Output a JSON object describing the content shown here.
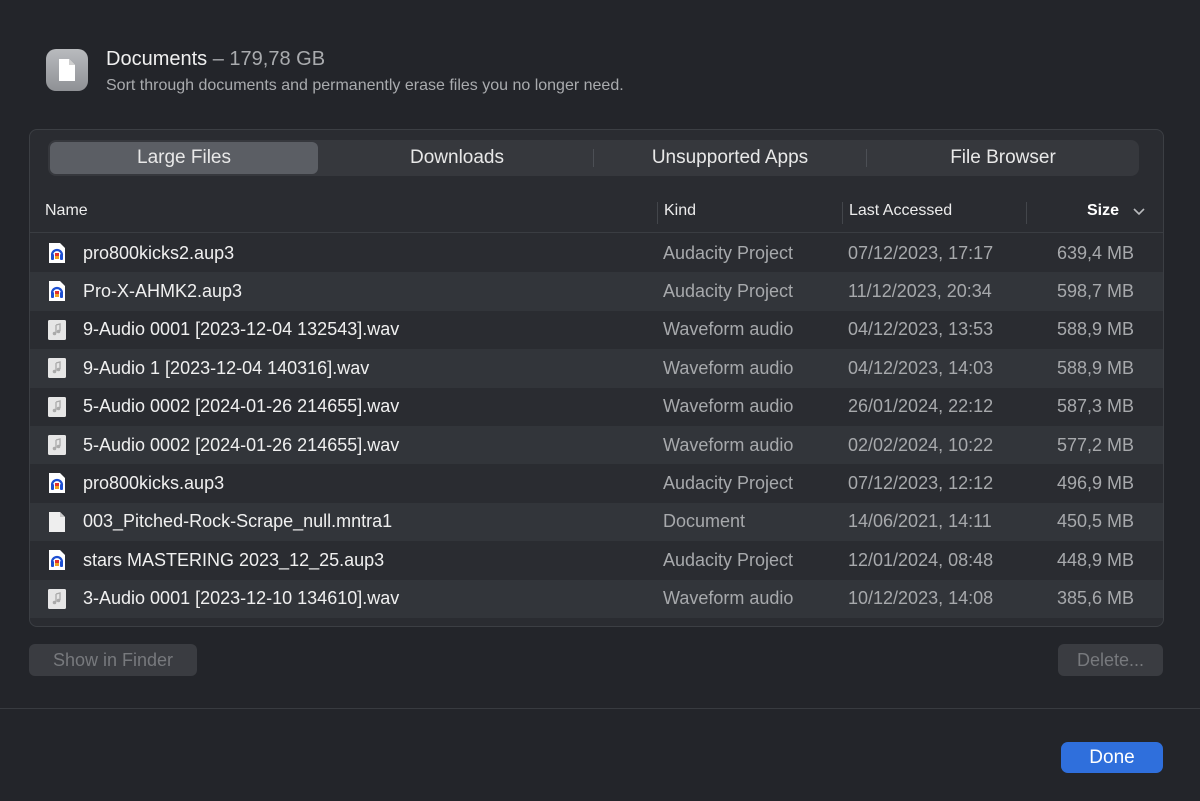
{
  "header": {
    "title": "Documents",
    "separator": "–",
    "size": "179,78 GB",
    "subtitle": "Sort through documents and permanently erase files you no longer need."
  },
  "tabs": [
    {
      "label": "Large Files",
      "active": true
    },
    {
      "label": "Downloads",
      "active": false
    },
    {
      "label": "Unsupported Apps",
      "active": false
    },
    {
      "label": "File Browser",
      "active": false
    }
  ],
  "columns": {
    "name": "Name",
    "kind": "Kind",
    "last_accessed": "Last Accessed",
    "size": "Size"
  },
  "rows": [
    {
      "icon": "audacity-icon",
      "name": "pro800kicks2.aup3",
      "kind": "Audacity Project",
      "last": "07/12/2023, 17:17",
      "size": "639,4 MB"
    },
    {
      "icon": "audacity-icon",
      "name": "Pro-X-AHMK2.aup3",
      "kind": "Audacity Project",
      "last": "11/12/2023, 20:34",
      "size": "598,7 MB"
    },
    {
      "icon": "audio-file-icon",
      "name": "9-Audio 0001 [2023-12-04 132543].wav",
      "kind": "Waveform audio",
      "last": "04/12/2023, 13:53",
      "size": "588,9 MB"
    },
    {
      "icon": "audio-file-icon",
      "name": "9-Audio 1 [2023-12-04 140316].wav",
      "kind": "Waveform audio",
      "last": "04/12/2023, 14:03",
      "size": "588,9 MB"
    },
    {
      "icon": "audio-file-icon",
      "name": "5-Audio 0002 [2024-01-26 214655].wav",
      "kind": "Waveform audio",
      "last": "26/01/2024, 22:12",
      "size": "587,3 MB"
    },
    {
      "icon": "audio-file-icon",
      "name": "5-Audio 0002 [2024-01-26 214655].wav",
      "kind": "Waveform audio",
      "last": "02/02/2024, 10:22",
      "size": "577,2 MB"
    },
    {
      "icon": "audacity-icon",
      "name": "pro800kicks.aup3",
      "kind": "Audacity Project",
      "last": "07/12/2023, 12:12",
      "size": "496,9 MB"
    },
    {
      "icon": "document-icon",
      "name": "003_Pitched-Rock-Scrape_null.mntra1",
      "kind": "Document",
      "last": "14/06/2021, 14:11",
      "size": "450,5 MB"
    },
    {
      "icon": "audacity-icon",
      "name": "stars MASTERING 2023_12_25.aup3",
      "kind": "Audacity Project",
      "last": "12/01/2024, 08:48",
      "size": "448,9 MB"
    },
    {
      "icon": "audio-file-icon",
      "name": "3-Audio 0001 [2023-12-10 134610].wav",
      "kind": "Waveform audio",
      "last": "10/12/2023, 14:08",
      "size": "385,6 MB"
    }
  ],
  "buttons": {
    "show_in_finder": "Show in Finder",
    "delete": "Delete...",
    "done": "Done"
  },
  "colors": {
    "accent": "#2f6fdc",
    "background": "#23252a"
  }
}
